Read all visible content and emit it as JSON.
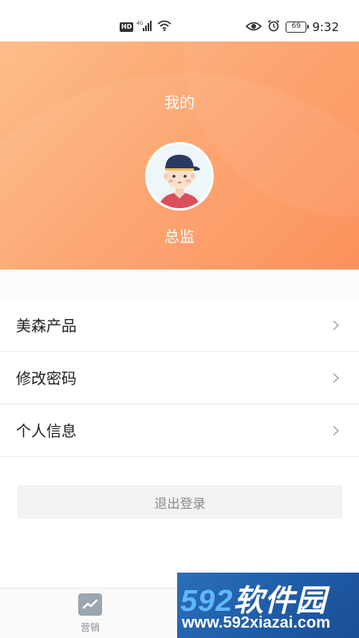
{
  "status_bar": {
    "hd": "HD",
    "signal_tag": "4G",
    "battery": "69",
    "time": "9:32",
    "icons": [
      "signal-icon",
      "wifi-icon",
      "eye-icon",
      "alarm-icon",
      "battery-icon"
    ]
  },
  "header": {
    "title": "我的",
    "role": "总监",
    "colors": {
      "gradient_start": "#fdbe8b",
      "gradient_end": "#fb8b52"
    }
  },
  "menu": {
    "items": [
      {
        "label": "美森产品"
      },
      {
        "label": "修改密码"
      },
      {
        "label": "个人信息"
      }
    ]
  },
  "logout": {
    "label": "退出登录"
  },
  "tabbar": {
    "items": [
      {
        "label": "营销",
        "icon": "chart-icon"
      }
    ]
  },
  "watermark": {
    "brand_num": "592",
    "brand_cn": "软件园",
    "url": "www.592xiazai.com"
  }
}
